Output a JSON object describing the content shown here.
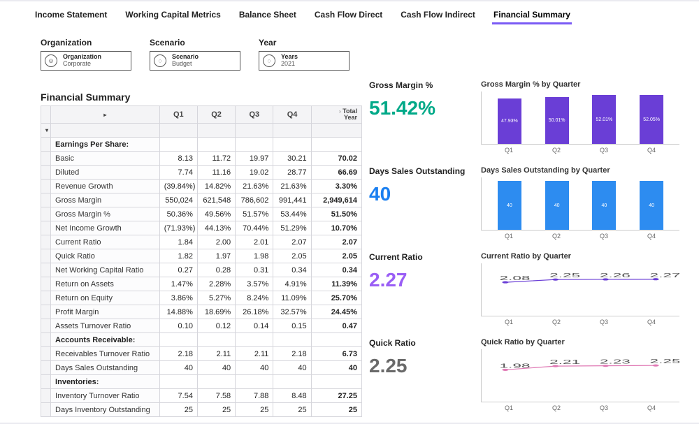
{
  "tabs": [
    {
      "label": "Income Statement",
      "active": false
    },
    {
      "label": "Working Capital Metrics",
      "active": false
    },
    {
      "label": "Balance Sheet",
      "active": false
    },
    {
      "label": "Cash Flow Direct",
      "active": false
    },
    {
      "label": "Cash Flow Indirect",
      "active": false
    },
    {
      "label": "Financial Summary",
      "active": true
    }
  ],
  "filters": {
    "org": {
      "title": "Organization",
      "line1": "Organization",
      "line2": "Corporate"
    },
    "scenario": {
      "title": "Scenario",
      "line1": "Scenario",
      "line2": "Budget"
    },
    "year": {
      "title": "Year",
      "line1": "Years",
      "line2": "2021"
    }
  },
  "section_title": "Financial Summary",
  "table": {
    "headers": [
      "Q1",
      "Q2",
      "Q3",
      "Q4"
    ],
    "total_header": "Total Year",
    "rows": [
      {
        "type": "section",
        "label": "Earnings Per Share:"
      },
      {
        "type": "data",
        "label": "Basic",
        "v": [
          "8.13",
          "11.72",
          "19.97",
          "30.21"
        ],
        "total": "70.02"
      },
      {
        "type": "data",
        "label": "Diluted",
        "v": [
          "7.74",
          "11.16",
          "19.02",
          "28.77"
        ],
        "total": "66.69"
      },
      {
        "type": "data",
        "label": "Revenue Growth",
        "v": [
          "(39.84%)",
          "14.82%",
          "21.63%",
          "21.63%"
        ],
        "total": "3.30%"
      },
      {
        "type": "data",
        "label": "Gross Margin",
        "v": [
          "550,024",
          "621,548",
          "786,602",
          "991,441"
        ],
        "total": "2,949,614"
      },
      {
        "type": "data",
        "label": "Gross Margin %",
        "v": [
          "50.36%",
          "49.56%",
          "51.57%",
          "53.44%"
        ],
        "total": "51.50%"
      },
      {
        "type": "data",
        "label": "Net Income Growth",
        "v": [
          "(71.93%)",
          "44.13%",
          "70.44%",
          "51.29%"
        ],
        "total": "10.70%"
      },
      {
        "type": "data",
        "label": "Current Ratio",
        "v": [
          "1.84",
          "2.00",
          "2.01",
          "2.07"
        ],
        "total": "2.07"
      },
      {
        "type": "data",
        "label": "Quick Ratio",
        "v": [
          "1.82",
          "1.97",
          "1.98",
          "2.05"
        ],
        "total": "2.05"
      },
      {
        "type": "data",
        "label": "Net Working Capital Ratio",
        "v": [
          "0.27",
          "0.28",
          "0.31",
          "0.34"
        ],
        "total": "0.34"
      },
      {
        "type": "data",
        "label": "Return on Assets",
        "v": [
          "1.47%",
          "2.28%",
          "3.57%",
          "4.91%"
        ],
        "total": "11.39%"
      },
      {
        "type": "data",
        "label": "Return on Equity",
        "v": [
          "3.86%",
          "5.27%",
          "8.24%",
          "11.09%"
        ],
        "total": "25.70%"
      },
      {
        "type": "data",
        "label": "Profit Margin",
        "v": [
          "14.88%",
          "18.69%",
          "26.18%",
          "32.57%"
        ],
        "total": "24.45%"
      },
      {
        "type": "data",
        "label": "Assets Turnover Ratio",
        "v": [
          "0.10",
          "0.12",
          "0.14",
          "0.15"
        ],
        "total": "0.47"
      },
      {
        "type": "section",
        "label": "Accounts Receivable:"
      },
      {
        "type": "data",
        "label": "Receivables Turnover Ratio",
        "v": [
          "2.18",
          "2.11",
          "2.11",
          "2.18"
        ],
        "total": "6.73"
      },
      {
        "type": "data",
        "label": "Days Sales Outstanding",
        "v": [
          "40",
          "40",
          "40",
          "40"
        ],
        "total": "40"
      },
      {
        "type": "section",
        "label": "Inventories:"
      },
      {
        "type": "data",
        "label": "Inventory Turnover Ratio",
        "v": [
          "7.54",
          "7.58",
          "7.88",
          "8.48"
        ],
        "total": "27.25"
      },
      {
        "type": "data",
        "label": "Days Inventory Outstanding",
        "v": [
          "25",
          "25",
          "25",
          "25"
        ],
        "total": "25"
      }
    ]
  },
  "kpis": [
    {
      "label": "Gross Margin %",
      "value": "51.42%",
      "color": "teal",
      "chart_title": "Gross Margin % by Quarter"
    },
    {
      "label": "Days Sales Outstanding",
      "value": "40",
      "color": "blue",
      "chart_title": "Days Sales Outstanding by Quarter"
    },
    {
      "label": "Current Ratio",
      "value": "2.27",
      "color": "purple",
      "chart_title": "Current Ratio by Quarter"
    },
    {
      "label": "Quick Ratio",
      "value": "2.25",
      "color": "gray",
      "chart_title": "Quick Ratio by Quarter"
    }
  ],
  "chart_data": [
    {
      "type": "bar",
      "title": "Gross Margin % by Quarter",
      "categories": [
        "Q1",
        "Q2",
        "Q3",
        "Q4"
      ],
      "values": [
        47.93,
        50.01,
        52.01,
        52.05
      ],
      "value_labels": [
        "47.93%",
        "50.01%",
        "52.01%",
        "52.05%"
      ],
      "color": "#6a3ed6"
    },
    {
      "type": "bar",
      "title": "Days Sales Outstanding by Quarter",
      "categories": [
        "Q1",
        "Q2",
        "Q3",
        "Q4"
      ],
      "values": [
        40,
        40,
        40,
        40
      ],
      "value_labels": [
        "40",
        "40",
        "40",
        "40"
      ],
      "color": "#2d8cf0"
    },
    {
      "type": "line",
      "title": "Current Ratio by Quarter",
      "categories": [
        "Q1",
        "Q2",
        "Q3",
        "Q4"
      ],
      "values": [
        2.08,
        2.25,
        2.26,
        2.27
      ],
      "value_labels": [
        "2.08",
        "2.25",
        "2.26",
        "2.27"
      ],
      "ylim": [
        0,
        3
      ],
      "color": "#6a3ed6"
    },
    {
      "type": "line",
      "title": "Quick Ratio by Quarter",
      "categories": [
        "Q1",
        "Q2",
        "Q3",
        "Q4"
      ],
      "values": [
        1.98,
        2.21,
        2.23,
        2.25
      ],
      "value_labels": [
        "1.98",
        "2.21",
        "2.23",
        "2.25"
      ],
      "ylim": [
        0,
        3
      ],
      "color": "#e07ab5"
    }
  ]
}
